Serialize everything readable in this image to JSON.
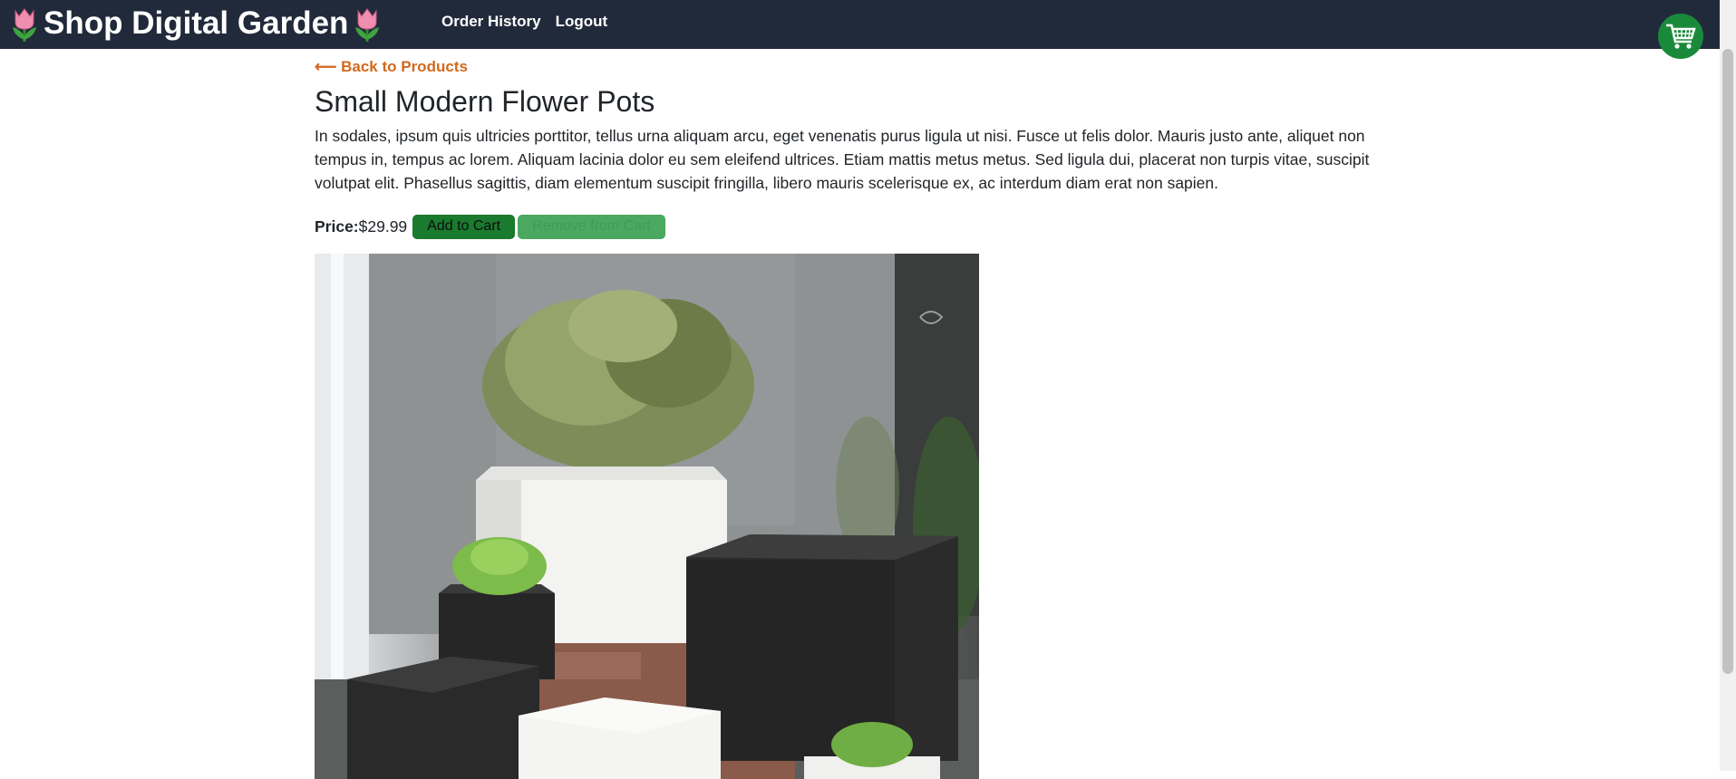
{
  "header": {
    "brand_title": "Shop Digital Garden",
    "brand_icon": "tulip-icon",
    "nav": [
      {
        "label": "Order History"
      },
      {
        "label": "Logout"
      }
    ],
    "cart_icon": "shopping-cart-icon",
    "bg_color": "#212a3a"
  },
  "product": {
    "back_link": "⟵ Back to Products",
    "name": "Small Modern Flower Pots",
    "description": "In sodales, ipsum quis ultricies porttitor, tellus urna aliquam arcu, eget venenatis purus ligula ut nisi. Fusce ut felis dolor. Mauris justo ante, aliquet non tempus in, tempus ac lorem. Aliquam lacinia dolor eu sem eleifend ultrices. Etiam mattis metus metus. Sed ligula dui, placerat non turpis vitae, suscipit volutpat elit. Phasellus sagittis, diam elementum suscipit fringilla, libero mauris scelerisque ex, ac interdum diam erat non sapien.",
    "price_label": "Price:",
    "price": "$29.99",
    "add_to_cart_label": "Add to Cart",
    "remove_from_cart_label": "Remove from Cart",
    "image_subject": "potted plants in white and black square pots"
  },
  "colors": {
    "accent_link": "#d2691e",
    "button_green": "#1a7a2e",
    "button_disabled_green": "#4aa860"
  }
}
